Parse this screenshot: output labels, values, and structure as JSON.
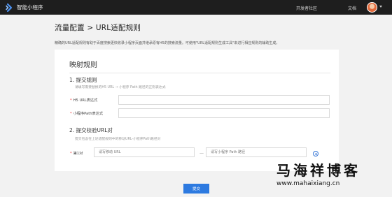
{
  "header": {
    "brand": "智能小程序",
    "nav": [
      "开发者社区",
      "文档"
    ]
  },
  "page": {
    "title": "流量配置 > URL适配规则",
    "intro": "精确的URL适配规则有助于百度搜索更快收录小程序页面并继承原有H5的搜索流量。可使用\"URL适配规则生成工具\"来进行相应规则的辅助生成。"
  },
  "card": {
    "title": "映射规则",
    "step1": {
      "title": "1. 提交规则",
      "desc": "请填写需要替换的H5 URL → 小程序 Path 路径的正则表达式",
      "fields": [
        {
          "label": "H5 URL表达式",
          "value": ""
        },
        {
          "label": "小程序Path表达式",
          "value": ""
        }
      ]
    },
    "step2": {
      "title": "2. 提交校验URL对",
      "desc": "提交包含在上述适配规则中的移动URL-小程序Path路径对",
      "pair_label": "第1对",
      "url_placeholder": "请写移动 URL",
      "path_placeholder": "请写小程序 Path 路径",
      "dash": "—"
    }
  },
  "submit_label": "提交",
  "watermark": {
    "cn": "马海祥博客",
    "url": "www.mahaixiang.cn"
  },
  "colors": {
    "accent": "#2d7ae0",
    "topbar": "#1e1e1e",
    "background": "#f2f2f2"
  }
}
